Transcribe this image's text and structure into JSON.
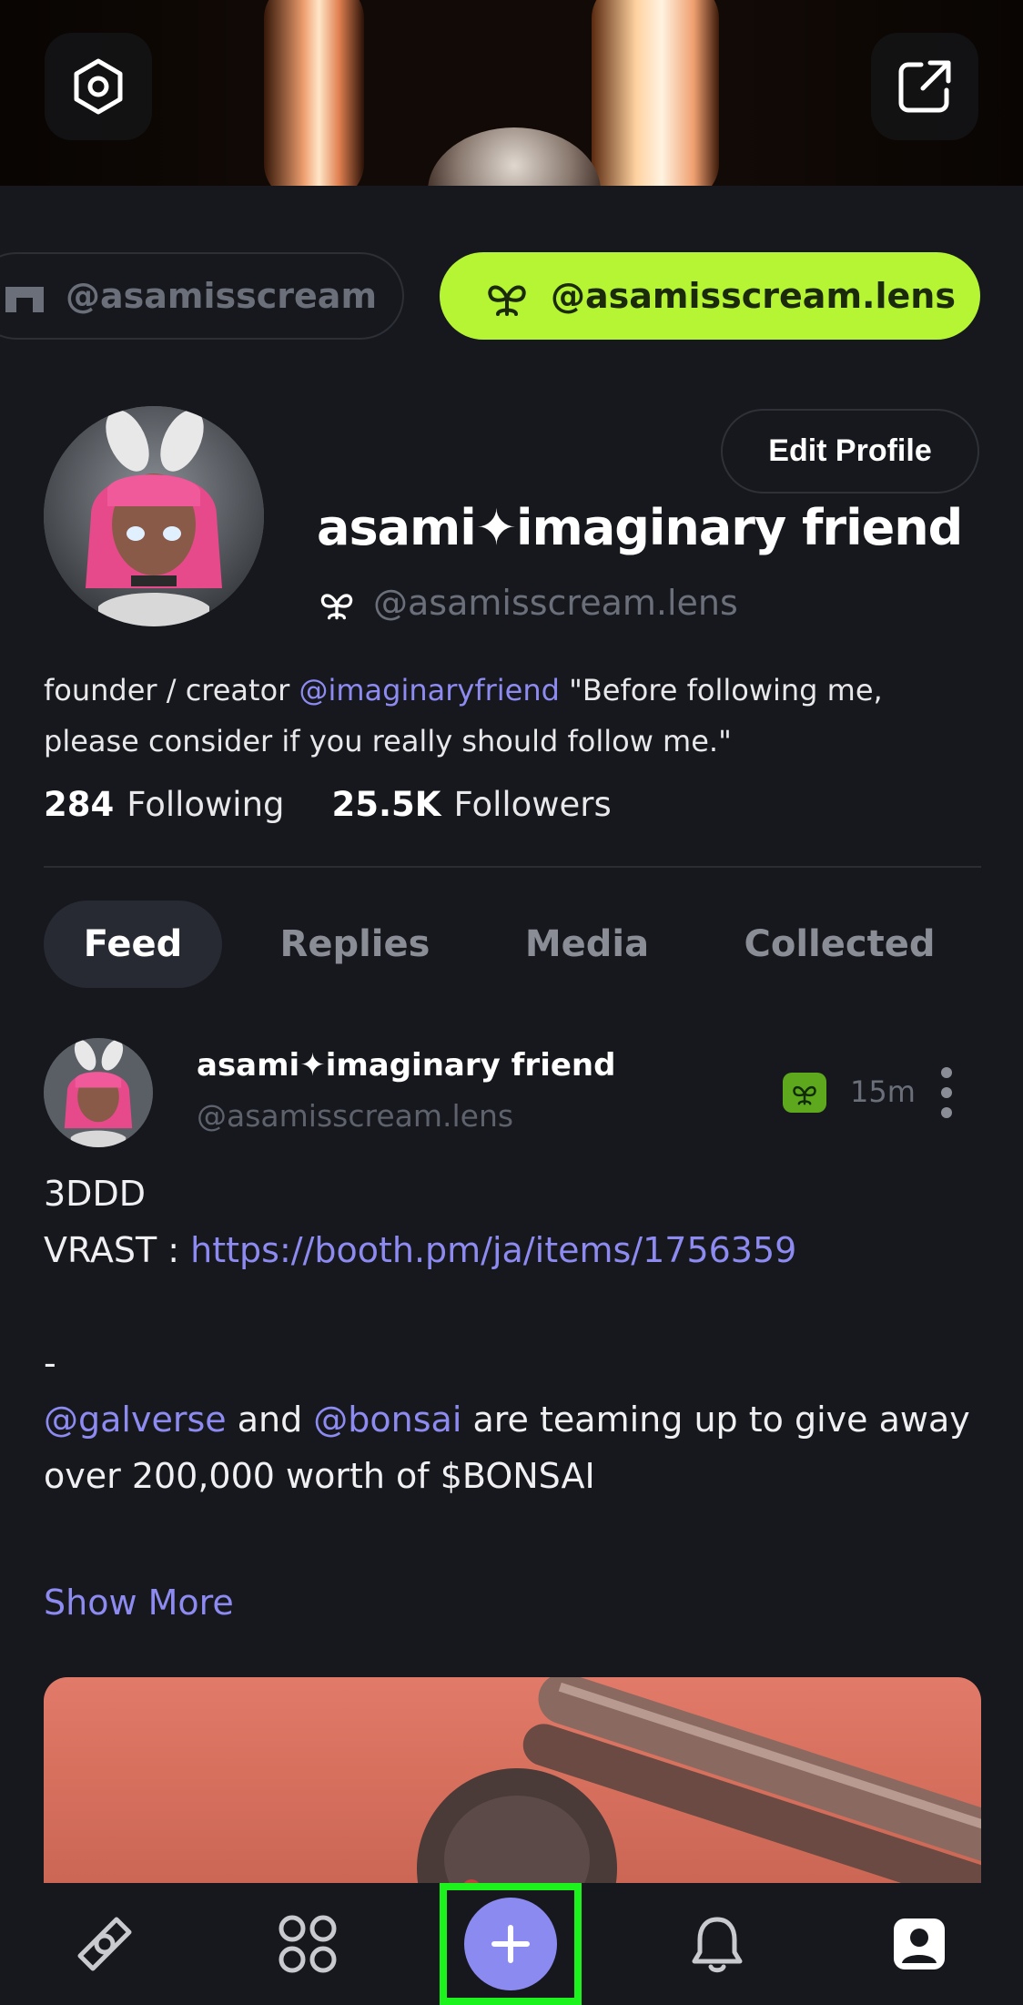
{
  "banner": {
    "settings_icon": "settings-hex-icon",
    "share_icon": "share-external-icon"
  },
  "handles": {
    "other_handle": "@asamisscream",
    "active_handle": "@asamisscream.lens"
  },
  "profile": {
    "edit_label": "Edit Profile",
    "display_name": "asami✦imaginary friend",
    "handle": "@asamisscream.lens",
    "bio_prefix": "founder / creator ",
    "bio_mention": "@imaginaryfriend",
    "bio_line1_suffix": " \"Before following me,",
    "bio_line2": "please consider if you really should follow me.\"",
    "following_count": "284",
    "following_label": "Following",
    "followers_count": "25.5K",
    "followers_label": "Followers"
  },
  "tabs": [
    {
      "label": "Feed"
    },
    {
      "label": "Replies"
    },
    {
      "label": "Media"
    },
    {
      "label": "Collected"
    }
  ],
  "post": {
    "author_name": "asami✦imaginary friend",
    "author_handle": "@asamisscream.lens",
    "time": "15m",
    "line1": "3DDD",
    "line2_prefix": "VRAST : ",
    "line2_link": "https://booth.pm/ja/items/1756359",
    "line3": "-",
    "mention1": "@galverse",
    "and_text": " and ",
    "mention2": "@bonsai",
    "line4_suffix": " are teaming up to give away",
    "line5": "over 200,000 worth of $BONSAI",
    "show_more": "Show More"
  },
  "colors": {
    "background": "#16181d",
    "accent_lens": "#b5f534",
    "link": "#8d8bf2",
    "create_button": "#8b8af0",
    "highlight": "#1cf21c"
  }
}
